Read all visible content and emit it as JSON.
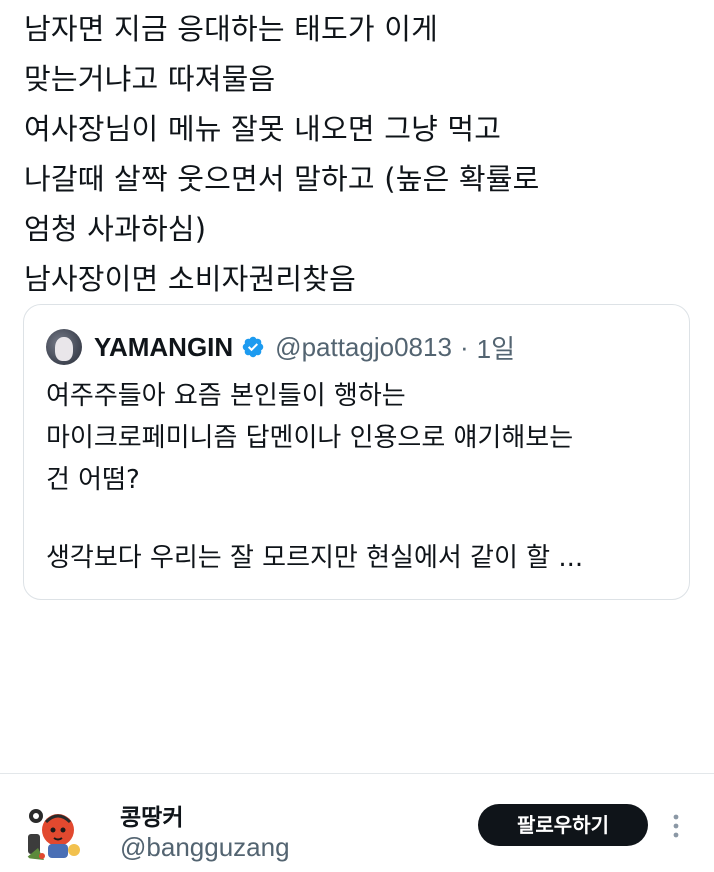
{
  "tweet": {
    "lines": [
      "남자면 지금 응대하는 태도가 이게",
      "맞는거냐고 따져물음",
      "여사장님이 메뉴 잘못 내오면 그냥 먹고",
      "나갈때 살짝 웃으면서 말하고 (높은 확률로",
      "엄청 사과하심)",
      "남사장이면 소비자권리찾음"
    ]
  },
  "quote": {
    "author_name": "YAMANGIN",
    "author_handle": "@pattagjo0813",
    "separator": "·",
    "time": "1일",
    "lines": [
      "여주주들아 요즘 본인들이 행하는",
      "마이크로페미니즘 답멘이나 인용으로 얘기해보는",
      "건 어떰?",
      "생각보다 우리는 잘 모르지만 현실에서 같이 할 ..."
    ],
    "verified_color": "#1d9bf0"
  },
  "footer": {
    "user_name": "콩땅커",
    "user_handle": "@bangguzang",
    "follow_label": "팔로우하기"
  },
  "colors": {
    "text": "#0f1419",
    "secondary_text": "#536471",
    "border": "#dde2e6",
    "button_bg": "#0f1419"
  },
  "icons": {
    "verified": "verified-badge-icon",
    "more": "more-vertical-icon"
  }
}
